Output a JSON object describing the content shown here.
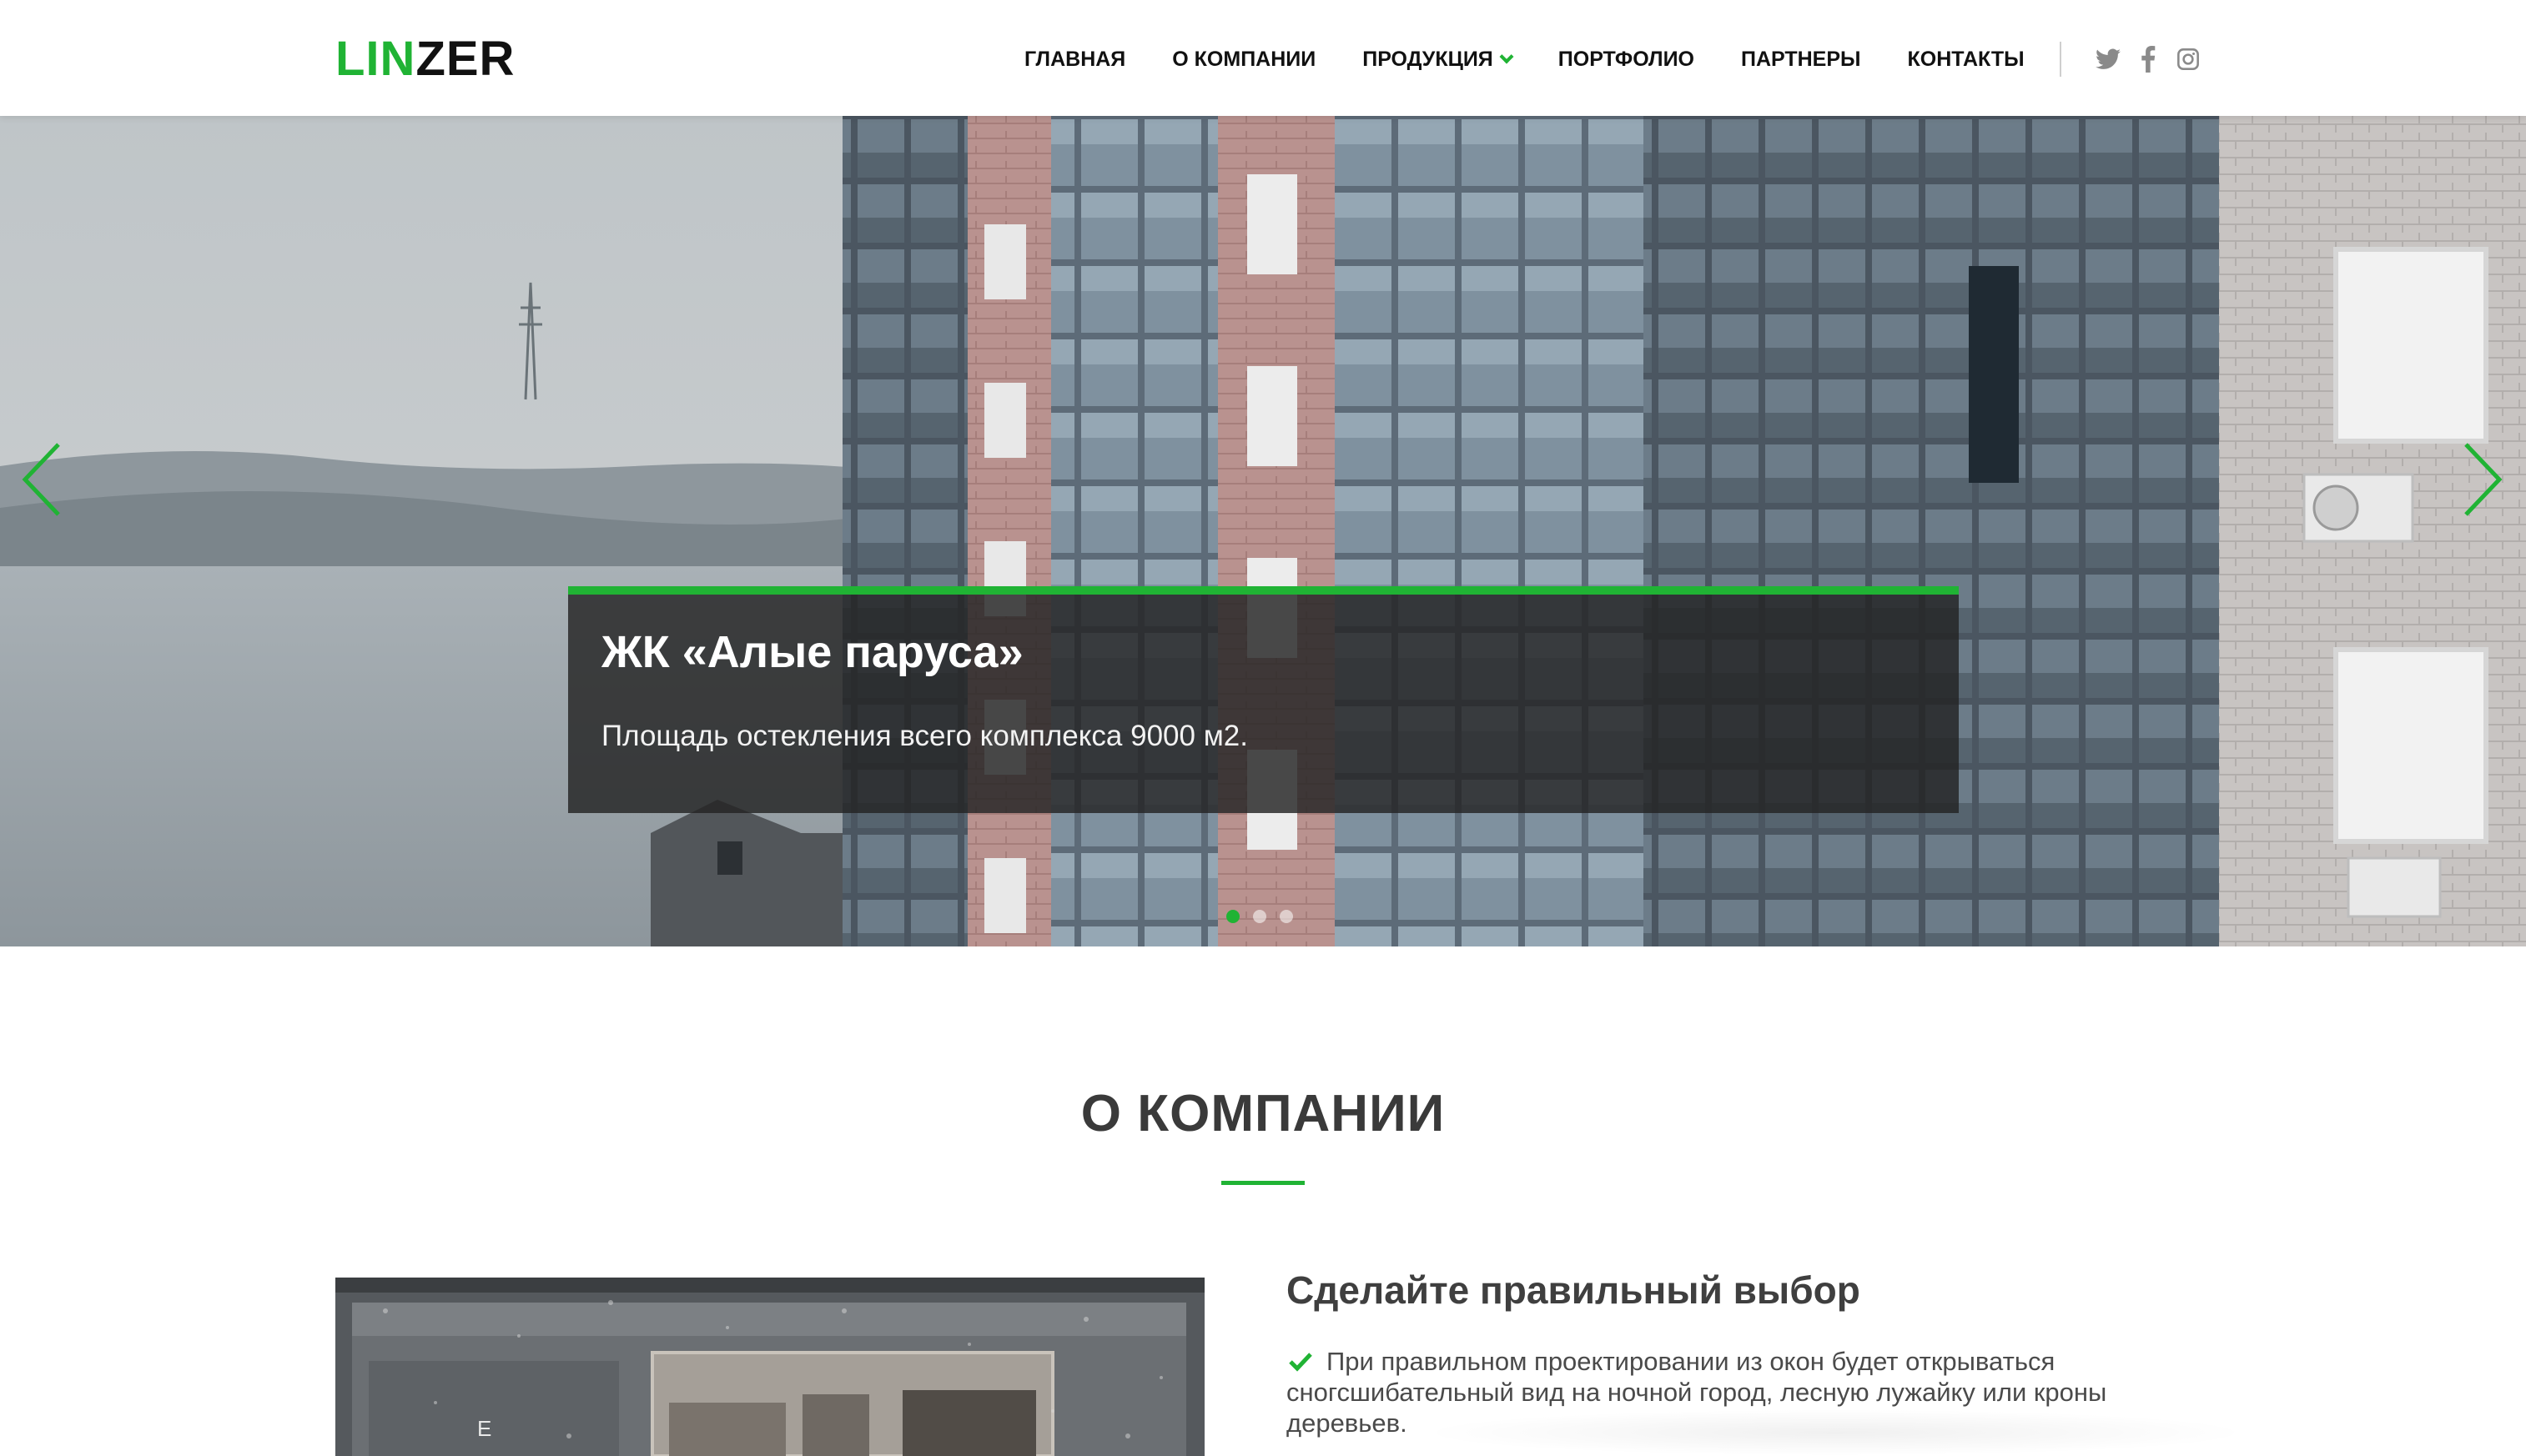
{
  "logo": {
    "part1": "LIN",
    "part2": "ZER"
  },
  "nav": {
    "items": [
      {
        "label": "ГЛАВНАЯ"
      },
      {
        "label": "О КОМПАНИИ"
      },
      {
        "label": "ПРОДУКЦИЯ",
        "has_dropdown": true
      },
      {
        "label": "ПОРТФОЛИО"
      },
      {
        "label": "ПАРТНЕРЫ"
      },
      {
        "label": "КОНТАКТЫ"
      }
    ],
    "social": [
      "twitter-icon",
      "facebook-icon",
      "instagram-icon"
    ]
  },
  "slider": {
    "title": "ЖК «Алые паруса»",
    "text": "Площадь остекления всего комплекса 9000 м2.",
    "slides_count": 3,
    "active_slide": 1
  },
  "about": {
    "section_title": "О КОМПАНИИ",
    "heading": "Сделайте правильный выбор",
    "text": "При правильном проектировании из окон будет открываться сногсшибательный вид на ночной город, лесную лужайку или кроны деревьев."
  },
  "colors": {
    "accent": "#20b334",
    "text_dark": "#111111",
    "caption_bg": "#232323"
  }
}
